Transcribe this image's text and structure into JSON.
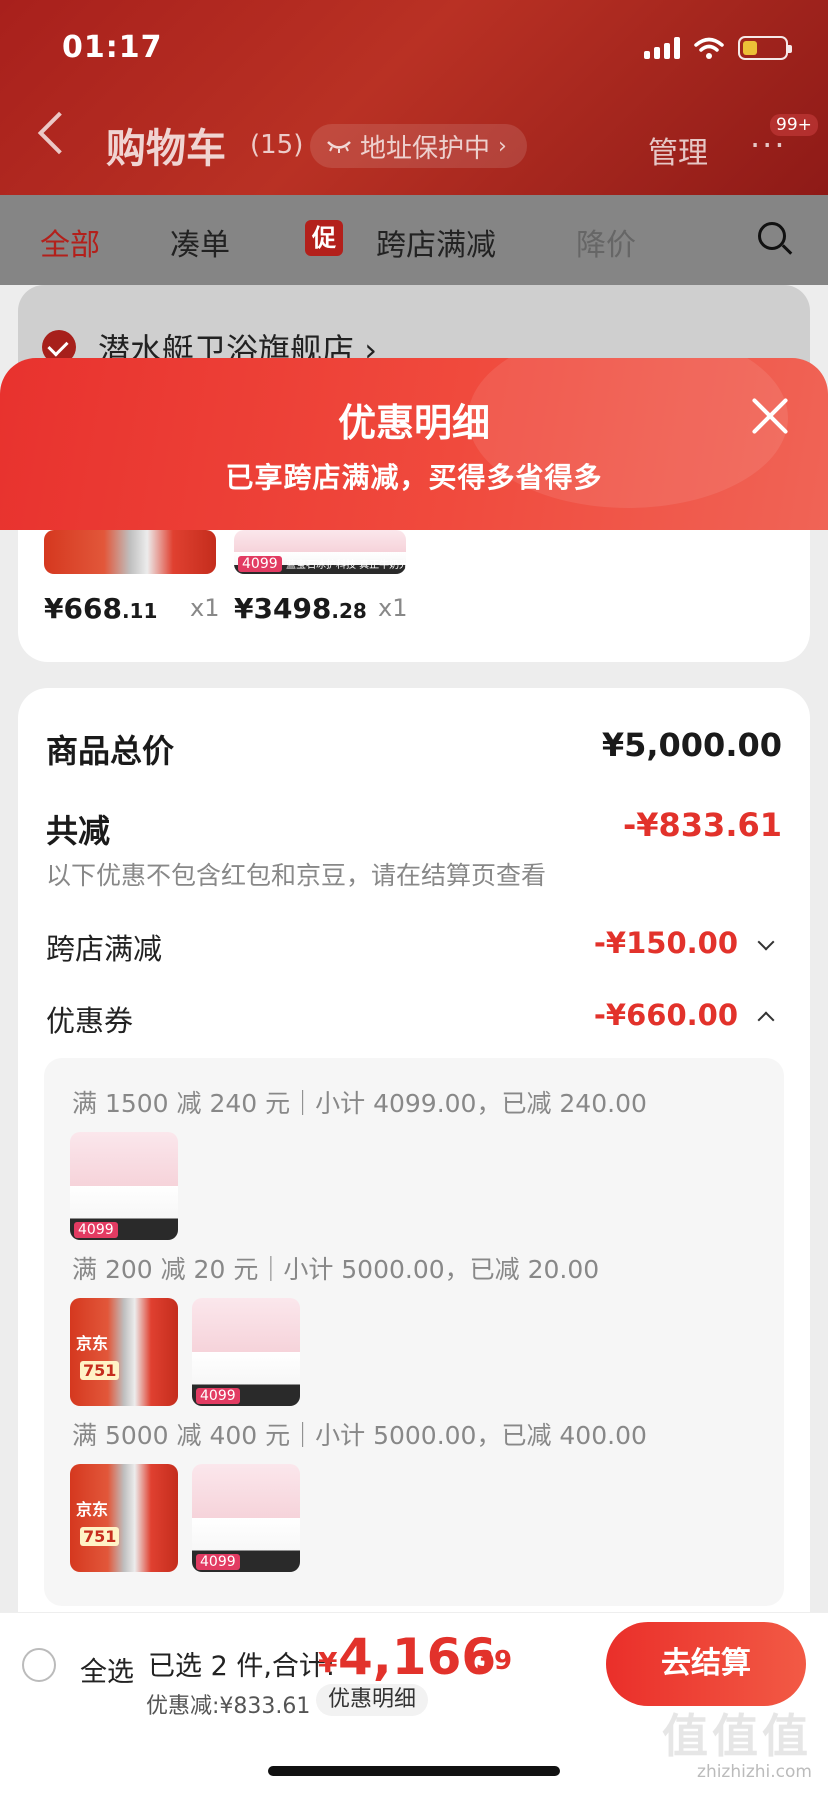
{
  "status_bar": {
    "time": "01:17"
  },
  "header": {
    "title": "购物车",
    "count": "(15)",
    "address_protect": "地址保护中",
    "manage": "管理",
    "more": "···",
    "badge": "99+"
  },
  "tabs": [
    {
      "label": "全部",
      "active": true
    },
    {
      "label": "凑单",
      "active": false
    },
    {
      "label": "促",
      "active": false
    },
    {
      "label": "跨店满减",
      "active": false
    },
    {
      "label": "降价",
      "active": false
    }
  ],
  "store": {
    "name": "潜水艇卫浴旗舰店"
  },
  "sheet": {
    "title": "优惠明细",
    "subtitle": "已享跨店满减，买得多省得多"
  },
  "products": [
    {
      "price_main": "¥668",
      "price_cents": ".11",
      "qty": "x1",
      "tag": "751"
    },
    {
      "price_main": "¥3498",
      "price_cents": ".28",
      "qty": "x1",
      "tag": "4099",
      "caption": "蓝宝石冰护科技 真正牛奶光"
    }
  ],
  "summary": {
    "total_label": "商品总价",
    "total_value": "¥5,000.00",
    "reduce_label": "共减",
    "reduce_value": "-¥833.61",
    "note": "以下优惠不包含红包和京豆，请在结算页查看",
    "cross_store_label": "跨店满减",
    "cross_store_value": "-¥150.00",
    "coupon_label": "优惠券",
    "coupon_value": "-¥660.00"
  },
  "coupons": [
    {
      "line": "满 1500 减 240 元｜小计 4099.00，已减 240.00"
    },
    {
      "line": "满 200 减 20 元｜小计 5000.00，已减 20.00"
    },
    {
      "line": "满 5000 减 400 元｜小计 5000.00，已减 400.00"
    }
  ],
  "bottom": {
    "select_all": "全选",
    "selected": "已选 2 件,合计:",
    "yen": "¥",
    "total_main": "4,166",
    "total_cents": ".39",
    "discount": "优惠减:¥833.61",
    "detail_pill": "优惠明细",
    "checkout": "去结算"
  },
  "watermark": {
    "logo": "值值值",
    "site": "zhizhizhi.com"
  }
}
